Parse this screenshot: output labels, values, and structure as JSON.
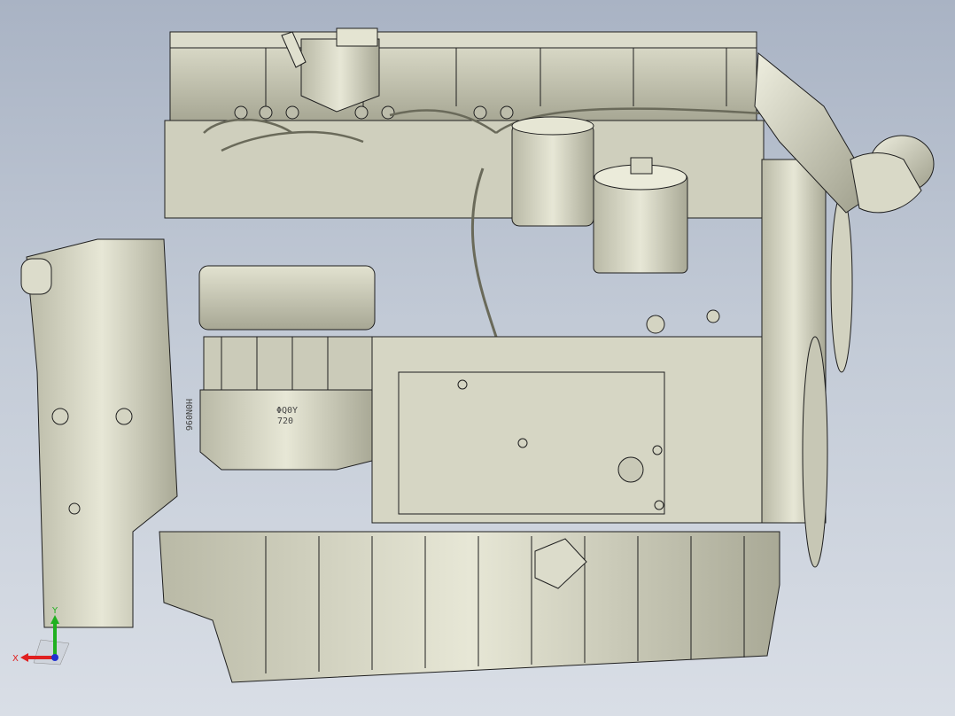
{
  "viewport": {
    "background_top": "#a9b3c4",
    "background_bottom": "#d9dee6"
  },
  "model": {
    "part_color": "#d4d4c2",
    "edge_color": "#1f1f1f",
    "stamp_text": "ΦQ0Y",
    "stamp_number": "720",
    "side_stamp": "H0N096"
  },
  "triad": {
    "x_label": "X",
    "y_label": "Y",
    "x_color": "#e02020",
    "y_color": "#20b020",
    "z_color": "#2030d0"
  }
}
